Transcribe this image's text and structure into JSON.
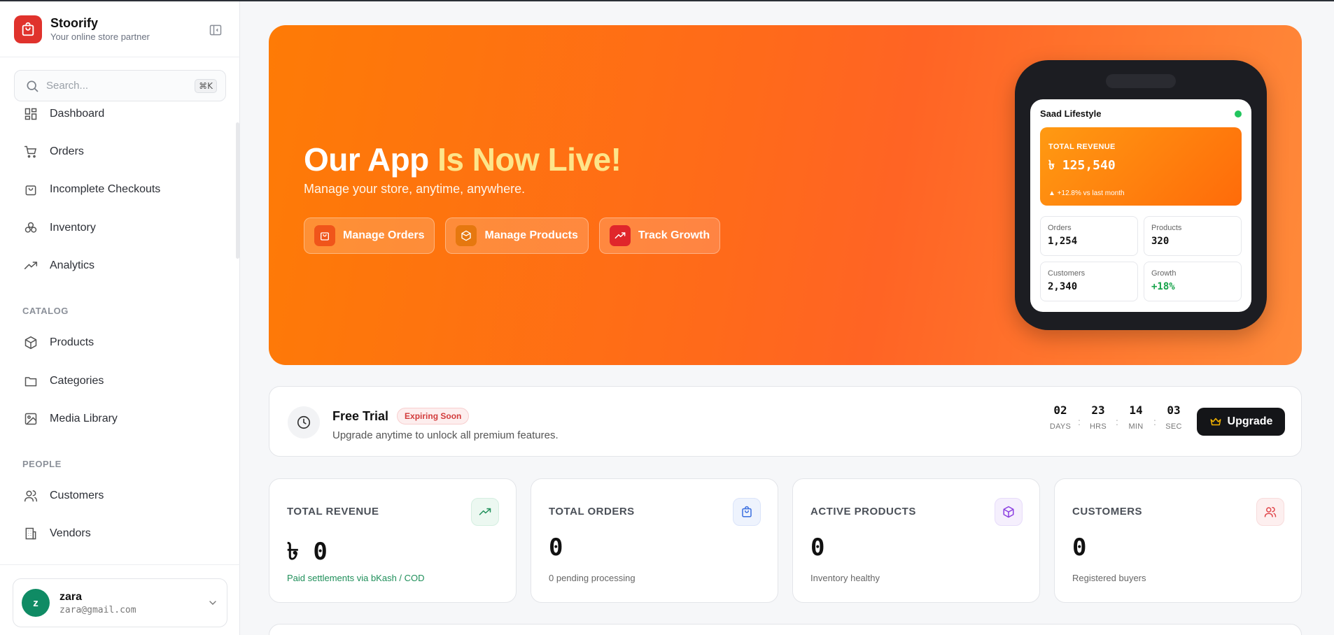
{
  "brand": {
    "name": "Stoorify",
    "tagline": "Your online store partner"
  },
  "search": {
    "placeholder": "Search...",
    "shortcut": "⌘K"
  },
  "nav": {
    "main": [
      {
        "label": "Dashboard",
        "icon": "dashboard-icon"
      },
      {
        "label": "Orders",
        "icon": "cart-icon"
      },
      {
        "label": "Incomplete Checkouts",
        "icon": "bag-icon"
      },
      {
        "label": "Inventory",
        "icon": "boxes-icon"
      },
      {
        "label": "Analytics",
        "icon": "trend-icon"
      }
    ],
    "catalog_label": "CATALOG",
    "catalog": [
      {
        "label": "Products",
        "icon": "package-icon"
      },
      {
        "label": "Categories",
        "icon": "folder-icon"
      },
      {
        "label": "Media Library",
        "icon": "image-icon"
      }
    ],
    "people_label": "PEOPLE",
    "people": [
      {
        "label": "Customers",
        "icon": "users-icon"
      },
      {
        "label": "Vendors",
        "icon": "building-icon"
      }
    ]
  },
  "user": {
    "initial": "z",
    "name": "zara",
    "email": "zara@gmail.com"
  },
  "hero": {
    "title_plain": "Our App ",
    "title_highlight": "Is Now Live!",
    "subtitle": "Manage your store, anytime, anywhere.",
    "buttons": [
      {
        "label": "Manage Orders",
        "color": "#f0551a"
      },
      {
        "label": "Manage Products",
        "color": "#e6780f"
      },
      {
        "label": "Track Growth",
        "color": "#e0262b"
      }
    ]
  },
  "phone": {
    "store_name": "Saad Lifestyle",
    "revenue_label": "TOTAL REVENUE",
    "revenue_value": "৳ 125,540",
    "revenue_note": "▲ +12.8% vs last month",
    "stats": [
      {
        "label": "Orders",
        "value": "1,254"
      },
      {
        "label": "Products",
        "value": "320"
      },
      {
        "label": "Customers",
        "value": "2,340"
      },
      {
        "label": "Growth",
        "value": "+18%"
      }
    ]
  },
  "trial": {
    "title": "Free Trial",
    "badge": "Expiring Soon",
    "subtitle": "Upgrade anytime to unlock all premium features.",
    "countdown": [
      {
        "value": "02",
        "label": "DAYS"
      },
      {
        "value": "23",
        "label": "HRS"
      },
      {
        "value": "14",
        "label": "MIN"
      },
      {
        "value": "03",
        "label": "SEC"
      }
    ],
    "upgrade_label": "Upgrade"
  },
  "stats": [
    {
      "label": "TOTAL REVENUE",
      "value": "৳ 0",
      "sub": "Paid settlements via bKash / COD",
      "icon": "trend-up-icon",
      "color": "#1f8f5a"
    },
    {
      "label": "TOTAL ORDERS",
      "value": "0",
      "sub": "0 pending processing",
      "icon": "bag-icon",
      "color": "#3b6fe0"
    },
    {
      "label": "ACTIVE PRODUCTS",
      "value": "0",
      "sub": "Inventory healthy",
      "icon": "package-icon",
      "color": "#8b3fe0"
    },
    {
      "label": "CUSTOMERS",
      "value": "0",
      "sub": "Registered buyers",
      "icon": "users-icon",
      "color": "#e0454a"
    }
  ],
  "colors": {
    "accent": "#fe7b06",
    "brand": "#e0322c",
    "dark": "#141518"
  }
}
